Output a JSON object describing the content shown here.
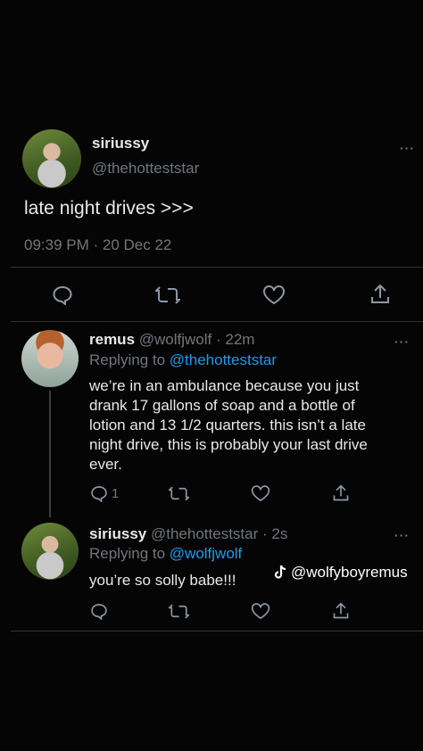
{
  "main_tweet": {
    "name": "siriussy",
    "handle": "@thehotteststar",
    "text": "late night drives >>>",
    "timestamp": "09:39 PM · 20 Dec 22",
    "more": "···"
  },
  "replies": [
    {
      "name": "remus",
      "handle": "@wolfjwolf · 22m",
      "replying_prefix": "Replying to ",
      "replying_to": "@thehotteststar",
      "lines": [
        "we’re in an ambulance because you just",
        "drank 17 gallons of soap and a bottle of",
        "lotion and 13 1/2 quarters. this isn’t a late",
        "night drive, this is probably your last drive",
        "ever."
      ],
      "reply_count": "1",
      "more": "···"
    },
    {
      "name": "siriussy",
      "handle": "@thehotteststar · 2s",
      "replying_prefix": "Replying to ",
      "replying_to": "@wolfjwolf",
      "text": "you’re so solly babe!!!",
      "more": "···"
    }
  ],
  "watermark": "@wolfyboyremus",
  "icons": [
    "reply-icon",
    "retweet-icon",
    "like-icon",
    "share-icon",
    "tiktok-icon",
    "more-icon"
  ]
}
